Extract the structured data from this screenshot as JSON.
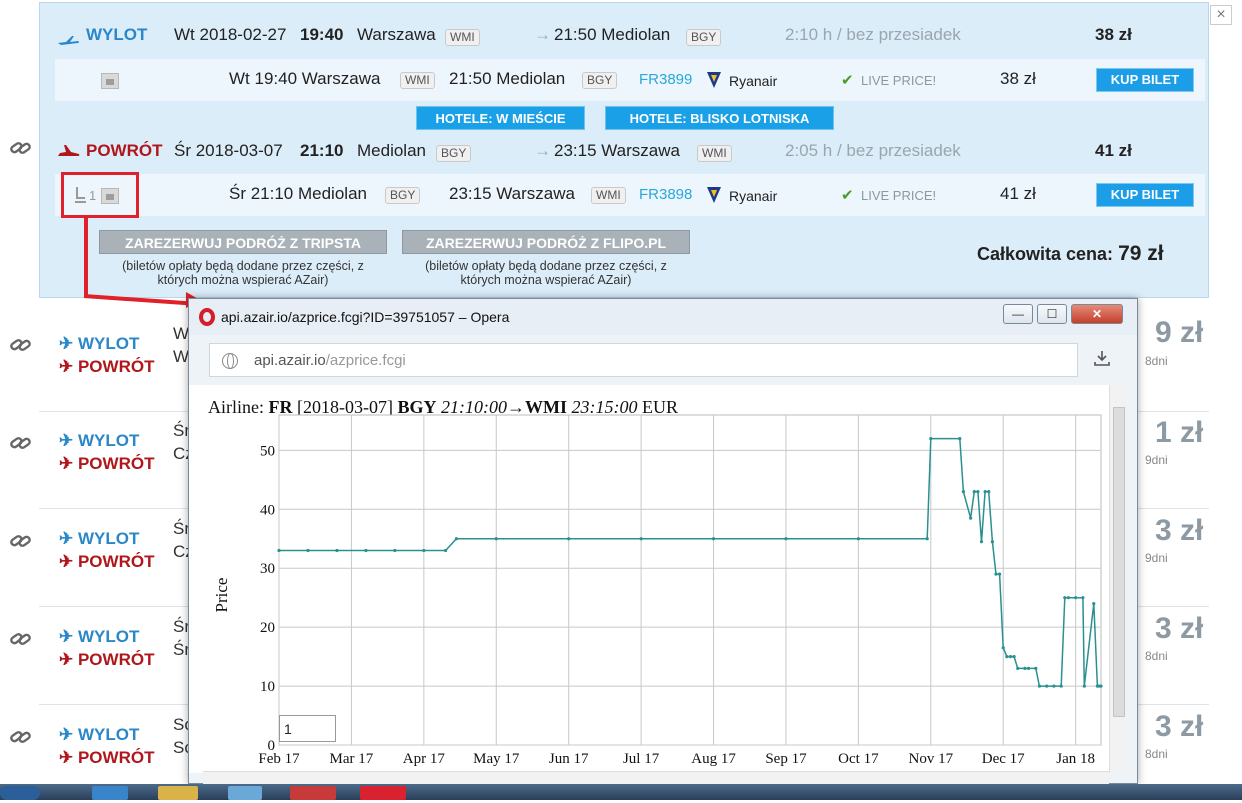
{
  "outbound": {
    "label": "WYLOT",
    "date": "Wt 2018-02-27",
    "time": "19:40",
    "from": "Warszawa",
    "from_code": "WMI",
    "arrow": "→",
    "arrive": "21:50 Mediolan",
    "to_code": "BGY",
    "duration": "2:10 h / bez przesiadek",
    "price": "38 zł",
    "segment": {
      "dep": "Wt 19:40 Warszawa",
      "dep_code": "WMI",
      "arr": "21:50 Mediolan",
      "arr_code": "BGY",
      "flight_no": "FR3899",
      "airline": "Ryanair",
      "live": "LIVE PRICE!",
      "price": "38 zł",
      "buy": "KUP BILET"
    }
  },
  "hotels": {
    "city": "HOTELE: W MIEŚCIE",
    "airport": "HOTELE: BLISKO LOTNISKA"
  },
  "return": {
    "label": "POWRÓT",
    "date": "Śr 2018-03-07",
    "time": "21:10",
    "from": "Mediolan",
    "from_code": "BGY",
    "arrow": "→",
    "arrive": "23:15 Warszawa",
    "to_code": "WMI",
    "duration": "2:05 h / bez przesiadek",
    "price": "41 zł",
    "segment": {
      "seat_count": "1",
      "dep": "Śr 21:10 Mediolan",
      "dep_code": "BGY",
      "arr": "23:15 Warszawa",
      "arr_code": "WMI",
      "flight_no": "FR3898",
      "airline": "Ryanair",
      "live": "LIVE PRICE!",
      "price": "41 zł",
      "buy": "KUP BILET"
    }
  },
  "reserve": {
    "tripsta": "ZAREZERWUJ PODRÓŻ Z TRIPSTA",
    "flipo": "ZAREZERWUJ PODRÓŻ Z FLIPO.PL",
    "note_line1": "(biletów opłaty będą dodane przez części, z",
    "note_line2": "których można wspierać AZair)"
  },
  "total": {
    "label": "Całkowita cena:",
    "value": "79 zł"
  },
  "list_rows": [
    {
      "dep": "WYLOT",
      "ret": "POWRÓT",
      "dep_init": "W",
      "ret_init": "W",
      "price_glimpse": "9 zł",
      "days": "8dni"
    },
    {
      "dep": "WYLOT",
      "ret": "POWRÓT",
      "dep_init": "Śr",
      "ret_init": "Cz",
      "price_glimpse": "1 zł",
      "days": "9dni"
    },
    {
      "dep": "WYLOT",
      "ret": "POWRÓT",
      "dep_init": "Śr",
      "ret_init": "Cz",
      "price_glimpse": "3 zł",
      "days": "9dni"
    },
    {
      "dep": "WYLOT",
      "ret": "POWRÓT",
      "dep_init": "Śr",
      "ret_init": "Śr",
      "price_glimpse": "3 zł",
      "days": "8dni"
    },
    {
      "dep": "WYLOT",
      "ret": "POWRÓT",
      "dep_init": "So",
      "ret_init": "So",
      "price_glimpse": "3 zł",
      "days": "8dni"
    }
  ],
  "close_label": "×",
  "browser": {
    "title": "api.azair.io/azprice.fcgi?ID=39751057 – Opera",
    "url_host": "api.azair.io",
    "url_path": "/azprice.fcgi",
    "minimize": "—",
    "maximize": "☐",
    "close": "✕",
    "download_icon": "download-icon"
  },
  "chart_header": {
    "prefix": "Airline:",
    "airline": "FR",
    "date": "[2018-03-07]",
    "from": "BGY",
    "dep_time": "21:10:00",
    "arrow": "→",
    "to": "WMI",
    "arr_time": "23:15:00",
    "currency": "EUR"
  },
  "zoom_value": "1",
  "chart_data": {
    "type": "line",
    "title": "",
    "xlabel": "",
    "ylabel": "Price",
    "x_ticks": [
      "Feb 17",
      "Mar 17",
      "Apr 17",
      "May 17",
      "Jun 17",
      "Jul 17",
      "Aug 17",
      "Sep 17",
      "Oct 17",
      "Nov 17",
      "Dec 17",
      "Jan 18"
    ],
    "y_ticks": [
      0,
      10,
      20,
      30,
      40,
      50
    ],
    "ylim": [
      0,
      56
    ],
    "xlim_months": [
      0,
      11.35
    ],
    "grid": true,
    "color": "#2a9090",
    "series": [
      {
        "x": [
          0,
          0.4,
          0.8,
          1.2,
          1.6,
          2.0,
          2.3,
          2.45,
          3.0,
          4.0,
          5.0,
          6.0,
          7.0,
          8.0,
          8.95,
          9.0,
          9.4,
          9.45,
          9.55,
          9.6,
          9.65,
          9.7,
          9.75,
          9.8,
          9.85,
          9.9,
          9.95,
          10.0,
          10.05,
          10.1,
          10.15,
          10.2,
          10.3,
          10.35,
          10.45,
          10.5,
          10.6,
          10.7,
          10.8,
          10.85,
          10.9,
          11.0,
          11.1,
          11.12,
          11.25,
          11.3,
          11.32,
          11.35
        ],
        "y": [
          33,
          33,
          33,
          33,
          33,
          33,
          33,
          35,
          35,
          35,
          35,
          35,
          35,
          35,
          35,
          52,
          52,
          43,
          38.5,
          43,
          43,
          34.5,
          43,
          43,
          34.5,
          29,
          29,
          16.5,
          15,
          15,
          15,
          13,
          13,
          13,
          13,
          10,
          10,
          10,
          10,
          25,
          25,
          25,
          25,
          10,
          24,
          10,
          10,
          10
        ]
      }
    ]
  }
}
